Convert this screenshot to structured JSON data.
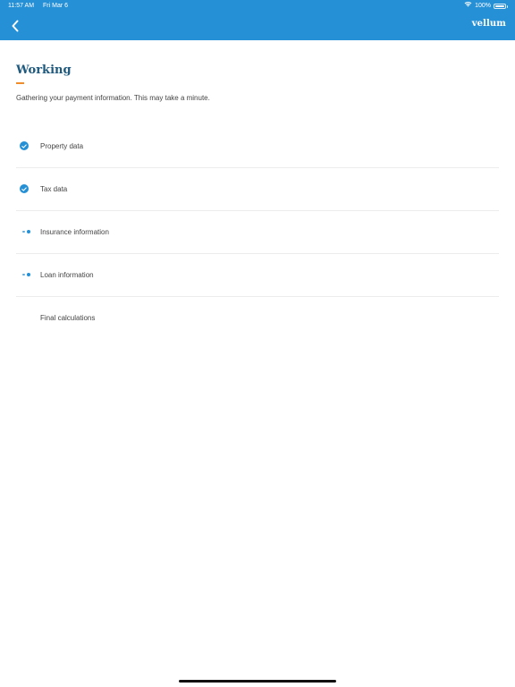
{
  "status_bar": {
    "time": "11:57 AM",
    "date": "Fri Mar 6",
    "battery_text": "100%"
  },
  "nav": {
    "back_icon": "chevron-left-icon",
    "brand": "vellum"
  },
  "page": {
    "title": "Working",
    "subtitle": "Gathering your payment information. This may take a minute."
  },
  "steps": [
    {
      "label": "Property data",
      "status": "complete"
    },
    {
      "label": "Tax data",
      "status": "complete"
    },
    {
      "label": "Insurance information",
      "status": "in-progress"
    },
    {
      "label": "Loan information",
      "status": "in-progress"
    },
    {
      "label": "Final calculations",
      "status": "pending"
    }
  ],
  "colors": {
    "header": "#2590d6",
    "title": "#1f5a7e",
    "accent": "#f08c2a"
  }
}
